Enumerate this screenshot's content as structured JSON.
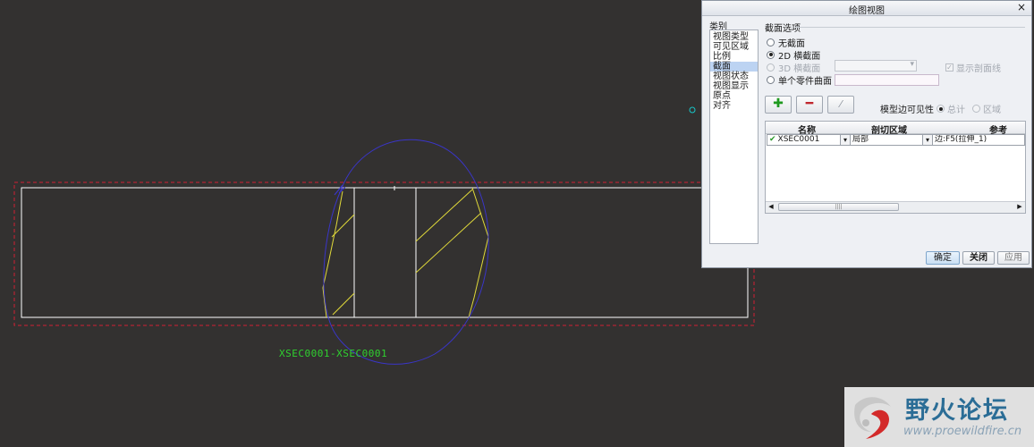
{
  "canvas": {
    "section_label": "XSEC0001-XSEC0001"
  },
  "colors": {
    "background": "#333130",
    "part_outline": "#ffffff",
    "boundary": "#d21f34",
    "hatch": "#e0d93a",
    "spline": "#3a35c8",
    "label": "#2fd12f",
    "point": "#18c6c8"
  },
  "dialog": {
    "title": "绘图视图",
    "close_icon": "close-icon",
    "category_label": "类别",
    "categories": [
      "视图类型",
      "可见区域",
      "比例",
      "截面",
      "视图状态",
      "视图显示",
      "原点",
      "对齐"
    ],
    "selected_category": "截面",
    "section_options_title": "截面选项",
    "options": {
      "none": "无截面",
      "two_d": "2D 横截面",
      "three_d": "3D 横截面",
      "single_part": "单个零件曲面"
    },
    "selected_option": "2D 横截面",
    "show_section_lines": "显示剖面线",
    "toolbar": {
      "add_icon": "plus-icon",
      "remove_icon": "minus-icon",
      "flip_icon": "flip-icon"
    },
    "edge_visibility_label": "模型边可见性",
    "visibility_total": "总计",
    "visibility_area": "区域",
    "table": {
      "headers": [
        "名称",
        "剖切区域",
        "参考"
      ],
      "rows": [
        {
          "name": "XSEC0001",
          "area": "局部",
          "reference": "边:F5(拉伸_1)"
        }
      ]
    },
    "buttons": {
      "ok": "确定",
      "close": "关闭",
      "apply": "应用"
    }
  },
  "watermark": {
    "name": "野火论坛",
    "url": "www.proewildfire.cn"
  }
}
